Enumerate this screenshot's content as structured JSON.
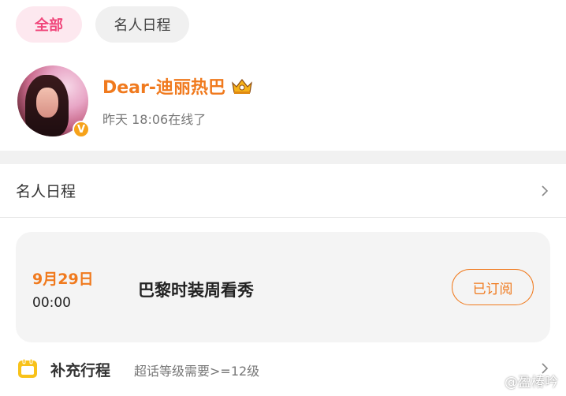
{
  "filter_tabs": {
    "all": "全部",
    "schedule": "名人日程"
  },
  "profile": {
    "username": "Dear-迪丽热巴",
    "verified_badge": "V",
    "status": "昨天 18:06在线了",
    "badge_icon": "crown-icon"
  },
  "section": {
    "title": "名人日程",
    "arrow_icon": "chevron-right-icon"
  },
  "event": {
    "date": "9月29日",
    "time": "00:00",
    "title": "巴黎时装周看秀",
    "subscribe_label": "已订阅"
  },
  "supplement": {
    "icon": "calendar-icon",
    "label": "补充行程",
    "note": "超话等级需要>=12级"
  },
  "watermark": {
    "text": "@盈椿吟",
    "icon": "weibo-logo"
  },
  "colors": {
    "accent": "#f07a1e",
    "pink": "#f0457a"
  }
}
